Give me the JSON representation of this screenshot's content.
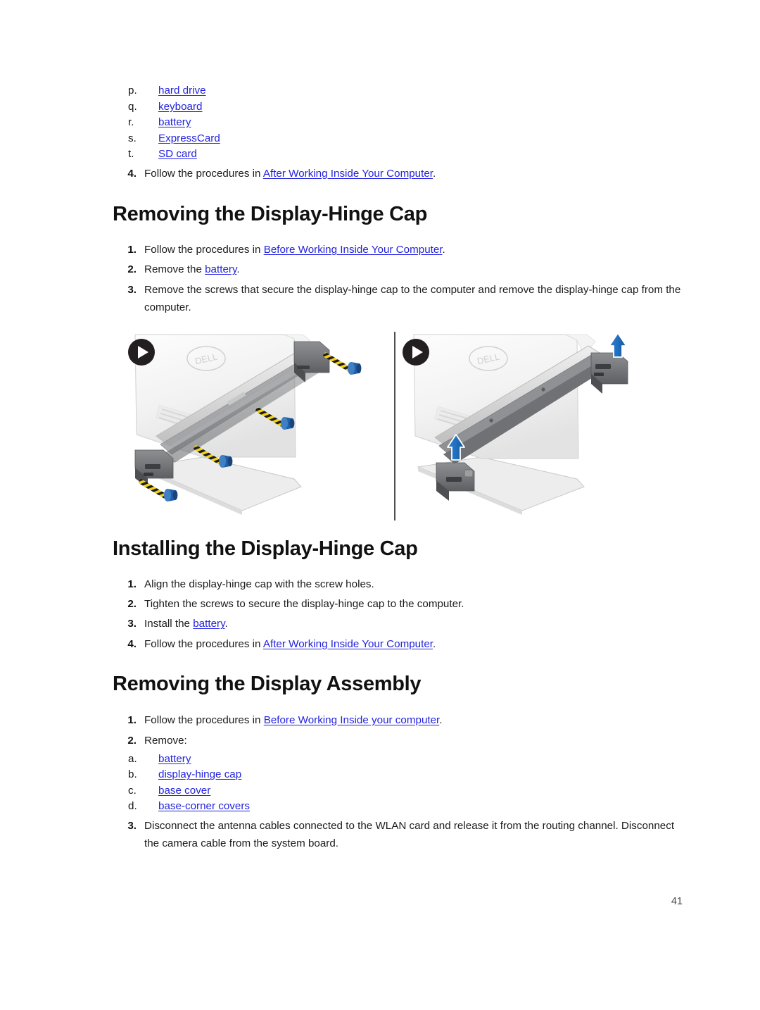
{
  "document": {
    "page_number": "41",
    "link_color": "#2323dd",
    "heading_color": "#111111",
    "body_color": "#1c1c1c"
  },
  "top_list": {
    "items": [
      {
        "marker": "p.",
        "label": "hard drive",
        "link": true
      },
      {
        "marker": "q.",
        "label": "keyboard",
        "link": true
      },
      {
        "marker": "r.",
        "label": "battery",
        "link": true
      },
      {
        "marker": "s.",
        "label": "ExpressCard",
        "link": true
      },
      {
        "marker": "t.",
        "label": "SD card",
        "link": true
      }
    ],
    "step4": {
      "marker": "4.",
      "text_before": "Follow the procedures in ",
      "link": "After Working Inside Your Computer",
      "text_after": "."
    }
  },
  "sections": [
    {
      "id": "removing-display-hinge-cap",
      "heading": "Removing the Display-Hinge Cap",
      "steps": [
        {
          "marker": "1.",
          "text_before": "Follow the procedures in ",
          "link": "Before Working Inside Your Computer",
          "text_after": "."
        },
        {
          "marker": "2.",
          "text_before": "Remove the ",
          "link": "battery",
          "text_after": "."
        },
        {
          "marker": "3.",
          "text_before": "Remove the screws that secure the display-hinge cap to the computer and remove the display-hinge cap from the computer.",
          "link": "",
          "text_after": ""
        }
      ]
    },
    {
      "id": "installing-display-hinge-cap",
      "heading": "Installing the Display-Hinge Cap",
      "steps": [
        {
          "marker": "1.",
          "text_before": "Align the display-hinge cap with the screw holes.",
          "link": "",
          "text_after": ""
        },
        {
          "marker": "2.",
          "text_before": "Tighten the screws to secure the display-hinge cap to the computer.",
          "link": "",
          "text_after": ""
        },
        {
          "marker": "3.",
          "text_before": "Install the ",
          "link": "battery",
          "text_after": "."
        },
        {
          "marker": "4.",
          "text_before": "Follow the procedures in ",
          "link": "After Working Inside Your Computer",
          "text_after": "."
        }
      ]
    },
    {
      "id": "removing-display-assembly",
      "heading": "Removing the Display Assembly",
      "steps": [
        {
          "marker": "1.",
          "text_before": "Follow the procedures in ",
          "link": "Before Working Inside your computer",
          "text_after": "."
        },
        {
          "marker": "2.",
          "text_before": "Remove:",
          "link": "",
          "text_after": ""
        },
        {
          "marker": "3.",
          "text_before": "Disconnect the antenna cables connected to the WLAN card and release it from the routing channel. Disconnect the camera cable from the system board.",
          "link": "",
          "text_after": ""
        }
      ],
      "sub_items": [
        {
          "marker": "a.",
          "label": "battery",
          "link": true
        },
        {
          "marker": "b.",
          "label": "display-hinge cap",
          "link": true
        },
        {
          "marker": "c.",
          "label": "base cover",
          "link": true
        },
        {
          "marker": "d.",
          "label": "base-corner covers",
          "link": true
        }
      ]
    }
  ],
  "figure": {
    "name": "display-hinge-cap-removal-figure",
    "left_panel": {
      "description": "Laptop rear corner with display-hinge cap and four screws being removed",
      "badge": "play-icon",
      "screw_count": 4,
      "screw_head_color": "#1f5fa8",
      "screw_shaft_colors": [
        "#f2d218",
        "#1a1a1a"
      ]
    },
    "right_panel": {
      "description": "Display-hinge cap lifted away from laptop, indicated by two blue arrows",
      "badge": "play-icon",
      "arrow_count": 2,
      "arrow_color": "#1f6fc0"
    },
    "brand_mark": "DELL"
  }
}
